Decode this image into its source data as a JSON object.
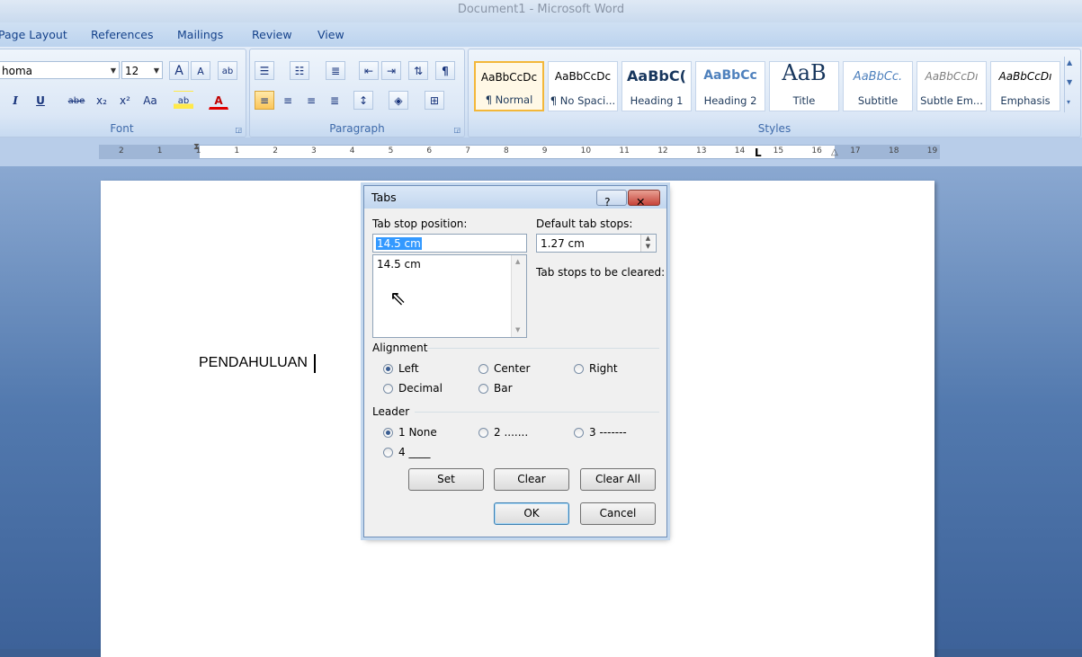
{
  "window": {
    "title": "Document1 - Microsoft Word"
  },
  "ribbon_tabs": [
    "Page Layout",
    "References",
    "Mailings",
    "Review",
    "View"
  ],
  "font_group": {
    "label": "Font",
    "font_name": "homa",
    "font_size": "12",
    "grow_label": "A",
    "shrink_label": "A",
    "clear_label": "ab",
    "italic": "I",
    "underline": "U",
    "strike": "abe",
    "subscript": "x₂",
    "superscript": "x²",
    "case": "Aa",
    "highlight": "ab",
    "font_color": "A"
  },
  "paragraph_group": {
    "label": "Paragraph",
    "show_marks": "¶"
  },
  "styles_group": {
    "label": "Styles",
    "tiles": [
      {
        "sample": "AaBbCcDc",
        "name": "¶ Normal"
      },
      {
        "sample": "AaBbCcDc",
        "name": "¶ No Spaci..."
      },
      {
        "sample": "AaBbC(",
        "name": "Heading 1"
      },
      {
        "sample": "AaBbCc",
        "name": "Heading 2"
      },
      {
        "sample": "AaB",
        "name": "Title"
      },
      {
        "sample": "AaBbCc.",
        "name": "Subtitle"
      },
      {
        "sample": "AaBbCcDı",
        "name": "Subtle Em..."
      },
      {
        "sample": "AaBbCcDı",
        "name": "Emphasis"
      }
    ]
  },
  "ruler": {
    "numbers": [
      "2",
      "1",
      "1",
      "1",
      "2",
      "3",
      "4",
      "5",
      "6",
      "7",
      "8",
      "9",
      "10",
      "11",
      "12",
      "13",
      "14",
      "15",
      "16",
      "17",
      "18",
      "19"
    ]
  },
  "document": {
    "text": "PENDAHULUAN"
  },
  "dialog": {
    "title": "Tabs",
    "help": "?",
    "close": "✕",
    "tab_stop_label": "Tab stop position:",
    "tab_stop_value": "14.5 cm",
    "tab_stops_list": [
      "14.5 cm"
    ],
    "default_label": "Default tab stops:",
    "default_value": "1.27 cm",
    "cleared_label": "Tab stops to be cleared:",
    "alignment_label": "Alignment",
    "alignment": {
      "left": "Left",
      "center": "Center",
      "right": "Right",
      "decimal": "Decimal",
      "bar": "Bar"
    },
    "alignment_selected": "Left",
    "leader_label": "Leader",
    "leader": {
      "l1": "1 None",
      "l2": "2 .......",
      "l3": "3 -------",
      "l4": "4 ____"
    },
    "leader_selected": "1 None",
    "set": "Set",
    "clear": "Clear",
    "clear_all": "Clear All",
    "ok": "OK",
    "cancel": "Cancel"
  }
}
